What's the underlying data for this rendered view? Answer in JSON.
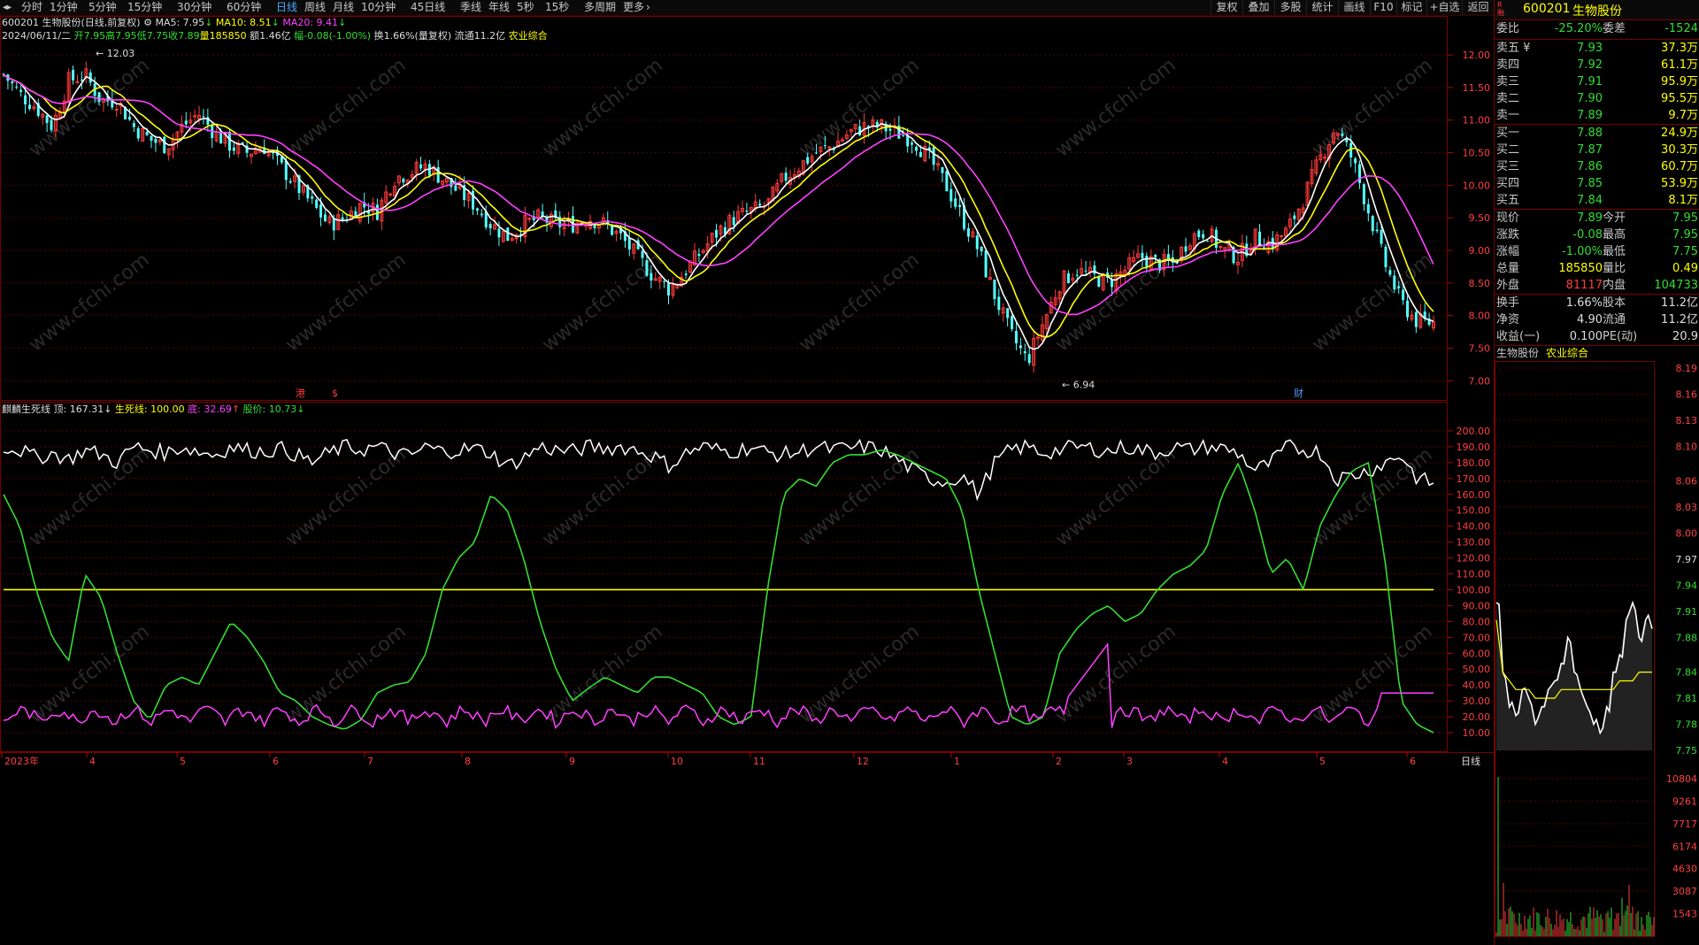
{
  "toolbar": {
    "nav_icon": "nav-arrows-icon",
    "tabs": [
      "分时",
      "1分钟",
      "5分钟",
      "15分钟",
      "30分钟",
      "60分钟",
      "日线",
      "周线",
      "月线",
      "10分钟",
      "45日线",
      "季线",
      "年线",
      "5秒",
      "15秒",
      "多周期",
      "更多"
    ],
    "active_tab": "日线",
    "right_buttons": [
      "复权",
      "叠加",
      "多股",
      "统计",
      "画线",
      "F10",
      "标记",
      "+自选",
      "返回"
    ]
  },
  "header": {
    "code": "600201",
    "name": "生物股份",
    "mode": "(日线,前复权)",
    "ma5_label": "MA5: 7.95",
    "ma10_label": "MA10: 8.51",
    "ma20_label": "MA20: 9.41",
    "date": "2024/06/11/二",
    "open": "开7.95",
    "high": "高7.95",
    "low": "低7.75",
    "close": "收7.89",
    "volume": "量185850",
    "amount": "额1.46亿",
    "change": "幅-0.08(-1.00%)",
    "turnover": "换1.66%(量复权)",
    "float": "流通11.2亿",
    "sector": "农业综合"
  },
  "main_chart": {
    "y_ticks": [
      "12.00",
      "11.50",
      "11.00",
      "10.50",
      "10.00",
      "9.50",
      "9.00",
      "8.50",
      "8.00",
      "7.50",
      "7.00"
    ],
    "high_label": "12.03",
    "low_label": "6.94",
    "markers": [
      "港",
      "$",
      "财"
    ],
    "colors": {
      "up": "#ff3b3b",
      "down": "#54ffff",
      "ma5": "#ffffff",
      "ma10": "#ffff00",
      "ma20": "#ff40ff"
    }
  },
  "indicator": {
    "name": "麒麟生死线",
    "top_label": "顶: 167.31",
    "line_label": "生死线: 100.00",
    "bottom_label": "底: 32.69",
    "price_label": "股价: 10.73",
    "y_ticks": [
      "200.00",
      "190.00",
      "180.00",
      "170.00",
      "160.00",
      "150.00",
      "140.00",
      "130.00",
      "120.00",
      "110.00",
      "100.00",
      "90.00",
      "80.00",
      "70.00",
      "60.00",
      "50.00",
      "40.00",
      "30.00",
      "20.00",
      "10.00"
    ],
    "colors": {
      "top": "#ffffff",
      "line": "#ffff00",
      "bottom": "#ff40ff",
      "price": "#33dd33"
    }
  },
  "x_axis": {
    "labels": [
      "2023年",
      "4",
      "5",
      "6",
      "7",
      "8",
      "9",
      "10",
      "11",
      "12",
      "1",
      "2",
      "3",
      "4",
      "5",
      "6"
    ],
    "period_label": "日线"
  },
  "chart_data": {
    "type": "candlestick",
    "title": "600201 生物股份(日线,前复权)",
    "ylim": [
      6.8,
      12.3
    ],
    "price_series": {
      "x_months": [
        "2023-03",
        "2023-04",
        "2023-05",
        "2023-06",
        "2023-07",
        "2023-08",
        "2023-09",
        "2023-10",
        "2023-11",
        "2023-12",
        "2024-01",
        "2024-02",
        "2024-03",
        "2024-04",
        "2024-05",
        "2024-06"
      ],
      "close_path": [
        11.7,
        11.4,
        11.2,
        10.9,
        11.6,
        11.7,
        11.3,
        11.3,
        10.9,
        10.7,
        10.6,
        10.9,
        11.1,
        10.8,
        10.6,
        10.5,
        10.6,
        10.3,
        10.0,
        9.7,
        9.4,
        9.5,
        9.7,
        9.6,
        10.1,
        10.2,
        10.3,
        10.1,
        9.9,
        9.7,
        9.4,
        9.2,
        9.4,
        9.5,
        9.4,
        9.4,
        9.5,
        9.4,
        9.2,
        8.9,
        8.6,
        8.4,
        8.7,
        9.0,
        9.3,
        9.5,
        9.6,
        9.7,
        10.1,
        10.3,
        10.5,
        10.6,
        10.8,
        10.9,
        10.9,
        10.8,
        10.7,
        10.4,
        10.0,
        9.5,
        9.0,
        8.3,
        7.7,
        7.3,
        7.9,
        8.5,
        8.7,
        8.6,
        8.5,
        8.7,
        8.9,
        8.8,
        8.8,
        9.2,
        9.3,
        9.0,
        8.9,
        9.2,
        9.1,
        9.3,
        9.8,
        10.4,
        10.9,
        10.4,
        9.6,
        8.8,
        8.2,
        7.9,
        7.89
      ],
      "ma5_last": 7.95,
      "ma10_last": 8.51,
      "ma20_last": 9.41
    },
    "indicator_series": {
      "name": "麒麟生死线",
      "ylim": [
        0,
        210
      ],
      "threshold": 100.0,
      "top_last": 167.31,
      "bottom_last": 32.69,
      "price_last": 10.73,
      "price_path": [
        160,
        140,
        100,
        70,
        55,
        110,
        95,
        60,
        30,
        18,
        40,
        45,
        40,
        60,
        80,
        70,
        55,
        35,
        30,
        20,
        15,
        12,
        18,
        35,
        40,
        42,
        60,
        100,
        120,
        130,
        160,
        150,
        120,
        80,
        50,
        30,
        38,
        45,
        40,
        35,
        45,
        45,
        40,
        35,
        20,
        15,
        20,
        100,
        160,
        170,
        165,
        180,
        185,
        185,
        188,
        185,
        180,
        175,
        170,
        150,
        100,
        60,
        20,
        15,
        20,
        60,
        75,
        85,
        90,
        80,
        85,
        100,
        110,
        115,
        125,
        160,
        180,
        150,
        110,
        120,
        100,
        140,
        160,
        175,
        180,
        120,
        30,
        15,
        10
      ],
      "top_path": [
        190,
        188,
        183,
        186,
        182,
        188,
        185,
        180,
        190,
        188,
        186,
        190,
        187,
        185,
        190,
        188,
        187,
        189,
        185,
        180,
        186,
        190,
        188,
        190,
        186,
        184,
        190,
        187,
        188,
        189,
        186,
        178,
        183,
        190,
        188,
        187,
        190,
        189,
        190,
        188,
        184,
        178,
        186,
        190,
        188,
        187,
        190,
        186,
        185,
        187,
        190,
        188,
        189,
        190,
        188,
        182,
        175,
        170,
        168,
        172,
        160,
        180,
        188,
        190,
        186,
        188,
        190,
        189,
        187,
        190,
        188,
        186,
        190,
        188,
        190,
        189,
        186,
        175,
        180,
        190,
        188,
        187,
        170,
        172,
        175,
        180,
        185,
        170,
        167
      ]
    },
    "minichart": {
      "code": "生物股份",
      "sector": "农业综合",
      "price_ticks": [
        "8.19",
        "8.16",
        "8.13",
        "8.10",
        "8.06",
        "8.03",
        "8.00",
        "7.97",
        "7.94",
        "7.91",
        "7.88",
        "7.84",
        "7.81",
        "7.78",
        "7.75"
      ],
      "volume_ticks": [
        "10804",
        "9261",
        "7717",
        "6174",
        "4630",
        "3087",
        "1543"
      ],
      "price_path": [
        7.92,
        7.84,
        7.8,
        7.79,
        7.82,
        7.81,
        7.78,
        7.8,
        7.82,
        7.83,
        7.85,
        7.88,
        7.84,
        7.82,
        7.8,
        7.78,
        7.77,
        7.8,
        7.84,
        7.86,
        7.9,
        7.92,
        7.88,
        7.9,
        7.89
      ],
      "avg_path": [
        7.9,
        7.84,
        7.83,
        7.82,
        7.82,
        7.82,
        7.81,
        7.81,
        7.81,
        7.81,
        7.82,
        7.82,
        7.82,
        7.82,
        7.82,
        7.82,
        7.82,
        7.82,
        7.82,
        7.83,
        7.83,
        7.83,
        7.84,
        7.84,
        7.84
      ]
    }
  },
  "quote": {
    "code": "600201",
    "name": "生物股份",
    "ratio_label": "委比",
    "ratio_value": "-25.20%",
    "diff_label": "委差",
    "diff_value": "-1524",
    "asks": [
      {
        "label": "卖五 ¥",
        "price": "7.93",
        "vol": "37.3万"
      },
      {
        "label": "卖四",
        "price": "7.92",
        "vol": "61.1万"
      },
      {
        "label": "卖三",
        "price": "7.91",
        "vol": "95.9万"
      },
      {
        "label": "卖二",
        "price": "7.90",
        "vol": "95.5万"
      },
      {
        "label": "卖一",
        "price": "7.89",
        "vol": "9.7万"
      }
    ],
    "bids": [
      {
        "label": "买一",
        "price": "7.88",
        "vol": "24.9万"
      },
      {
        "label": "买二",
        "price": "7.87",
        "vol": "30.3万"
      },
      {
        "label": "买三",
        "price": "7.86",
        "vol": "60.7万"
      },
      {
        "label": "买四",
        "price": "7.85",
        "vol": "53.9万"
      },
      {
        "label": "买五",
        "price": "7.84",
        "vol": "8.1万"
      }
    ],
    "stats": [
      {
        "l1": "现价",
        "v1": "7.89",
        "c1": "g",
        "l2": "今开",
        "v2": "7.95",
        "c2": "g"
      },
      {
        "l1": "涨跌",
        "v1": "-0.08",
        "c1": "g",
        "l2": "最高",
        "v2": "7.95",
        "c2": "g"
      },
      {
        "l1": "涨幅",
        "v1": "-1.00%",
        "c1": "g",
        "l2": "最低",
        "v2": "7.75",
        "c2": "g"
      },
      {
        "l1": "总量",
        "v1": "185850",
        "c1": "y",
        "l2": "量比",
        "v2": "0.49",
        "c2": "y"
      },
      {
        "l1": "外盘",
        "v1": "81117",
        "c1": "r",
        "l2": "内盘",
        "v2": "104733",
        "c2": "g"
      }
    ],
    "stats2": [
      {
        "l1": "换手",
        "v1": "1.66%",
        "l2": "股本",
        "v2": "11.2亿"
      },
      {
        "l1": "净资",
        "v1": "4.90",
        "l2": "流通",
        "v2": "11.2亿"
      },
      {
        "l1": "收益(一)",
        "v1": "0.100",
        "l2": "PE(动)",
        "v2": "20.9"
      }
    ]
  },
  "watermark": "www.cfchi.com"
}
